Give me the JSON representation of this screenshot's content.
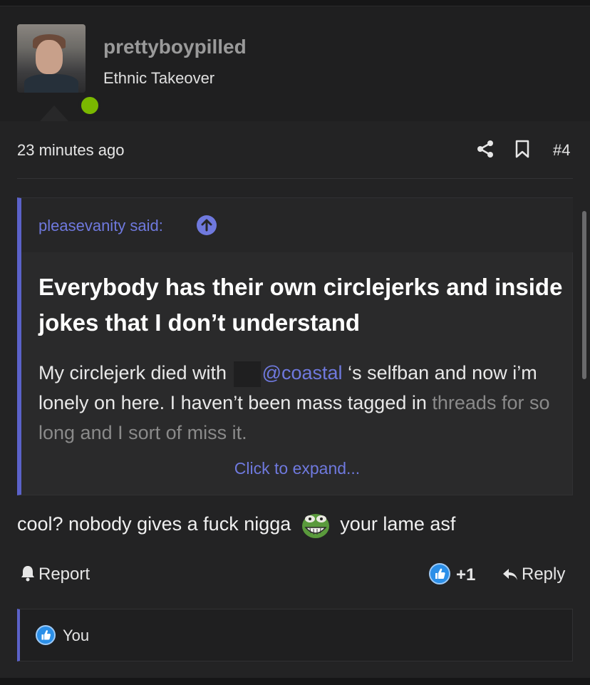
{
  "user": {
    "username": "prettyboypilled",
    "title": "Ethnic Takeover",
    "online_color": "#7ab800"
  },
  "post": {
    "timestamp": "23 minutes ago",
    "number": "#4",
    "icons": [
      "share-icon",
      "bookmark-icon"
    ]
  },
  "quote": {
    "author": "pleasevanity said:",
    "bold_text": "Everybody has their own circlejerks and inside jokes that I don’t understand",
    "text_before_mention": "My circlejerk died with",
    "mention": "@coastal",
    "text_after_mention": " ‘s selfban and now i’m lonely on here. I haven’t been mass tagged in",
    "faded_line": "threads for so long and I sort of miss it.",
    "expand_label": "Click to expand..."
  },
  "reply": {
    "text_before_emoji": "cool? nobody gives a fuck nigga",
    "text_after_emoji": "your lame asf",
    "emoji": "pepe-laugh-icon"
  },
  "actions": {
    "report_label": "Report",
    "like_count": "+1",
    "reply_label": "Reply"
  },
  "reactions": {
    "users": "You"
  },
  "colors": {
    "accent": "#6f79de",
    "quote_bar": "#5b62c9",
    "like_blue": "#2b8fe8",
    "background": "#1c1c1d"
  }
}
